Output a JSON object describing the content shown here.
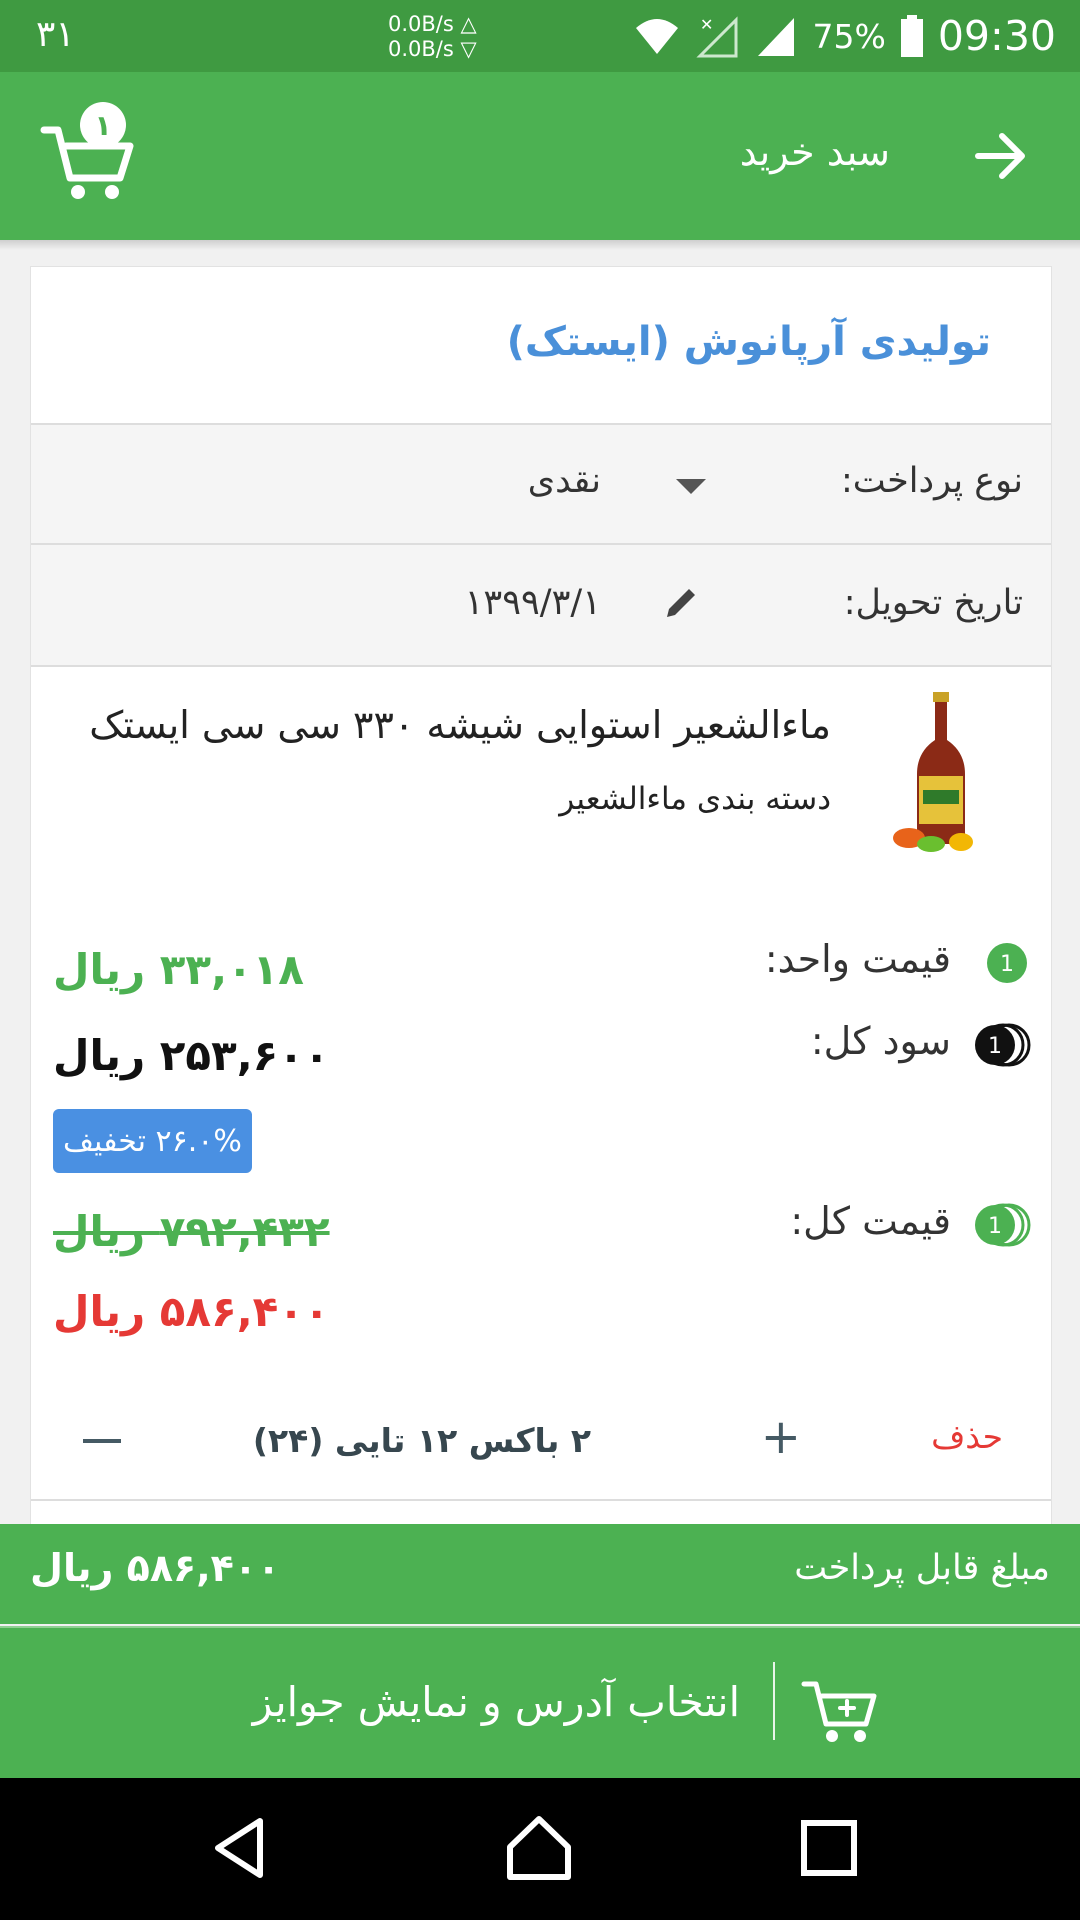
{
  "status_bar": {
    "left_number": "۳۱",
    "net_up": "0.0B/s △",
    "net_down": "0.0B/s ▽",
    "battery": "75%",
    "time": "09:30",
    "icons": [
      "wifi-icon",
      "no-signal-icon",
      "signal-icon",
      "battery-icon"
    ]
  },
  "app_bar": {
    "title": "سبد خرید",
    "cart_badge": "۱",
    "icons": [
      "arrow-forward-icon",
      "cart-icon"
    ]
  },
  "card": {
    "supplier": "تولیدی آرپانوش (ایستک)",
    "payment": {
      "label": "نوع پرداخت:",
      "value": "نقدی"
    },
    "delivery": {
      "label": "تاریخ تحویل:",
      "value": "۱۳۹۹/۳/۱"
    },
    "product": {
      "name": "ماءالشعیر استوایی شیشه ۳۳۰ سی سی ایستک",
      "category": "دسته بندی ماءالشعیر"
    },
    "unit_price": {
      "label": "قیمت واحد:",
      "value": "۳۳,۰۱۸ ریال",
      "icon_number": "1"
    },
    "total_profit": {
      "label": "سود کل:",
      "value": "۲۵۳,۶۰۰ ریال",
      "icon_number": "1"
    },
    "discount": "۲۶.۰% تخفیف",
    "total_price": {
      "label": "قیمت کل:",
      "old_value": "۷۹۲,۴۳۲ ریال",
      "new_value": "۵۸۶,۴۰۰ ریال",
      "icon_number": "1"
    },
    "quantity": {
      "delete_label": "حذف",
      "text": "۲ باکس ۱۲ تایی (۲۴)"
    }
  },
  "footer": {
    "payable_label": "مبلغ قابل پرداخت",
    "payable_total": "۵۸۶,۴۰۰ ریال",
    "checkout_label": "انتخاب آدرس و نمایش جوایز"
  },
  "colors": {
    "primary": "#4cb152",
    "status_bar": "#3f9a41",
    "link_blue": "#4a90d9",
    "danger": "#e53935",
    "badge_blue": "#4a90e2"
  }
}
